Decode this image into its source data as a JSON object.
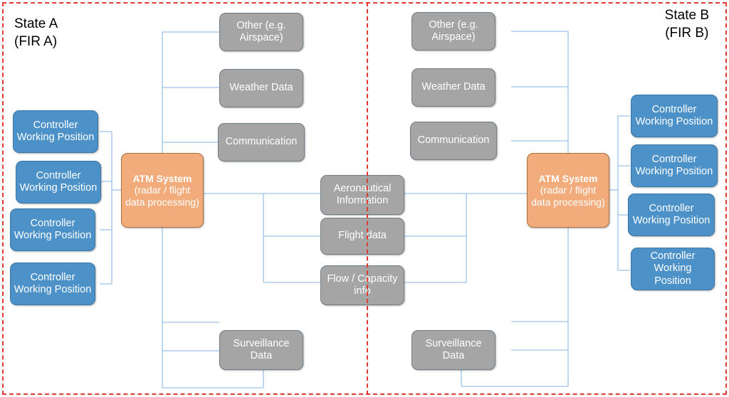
{
  "diagram": {
    "title_left": {
      "line1": "State A",
      "line2": "(FIR A)"
    },
    "title_right": {
      "line1": "State B",
      "line2": "(FIR B)"
    },
    "colors": {
      "blue": "#4C91C8",
      "gray": "#A5A5A5",
      "orange": "#F2AC7C",
      "border_red": "#E03A34",
      "connector": "#9DC3E6",
      "text": "#FFFFFF"
    },
    "state_a": {
      "controller_positions": [
        {
          "l1": "Controller",
          "l2": "Working",
          "l3": "Position"
        },
        {
          "l1": "Controller",
          "l2": "Working",
          "l3": "Position"
        },
        {
          "l1": "Controller",
          "l2": "Working",
          "l3": "Position"
        },
        {
          "l1": "Controller",
          "l2": "Working",
          "l3": "Position"
        }
      ],
      "atm": {
        "title": "ATM System",
        "l1": "(radar / flight",
        "l2": "data",
        "l3": "processing)"
      },
      "services": [
        {
          "l1": "Other",
          "l2": "(e.g. Airspace)"
        },
        {
          "l1": "Weather Data",
          "l2": ""
        },
        {
          "l1": "Communication",
          "l2": ""
        }
      ],
      "surveillance": {
        "l1": "Surveillance",
        "l2": "Data"
      }
    },
    "state_b": {
      "controller_positions": [
        {
          "l1": "Controller",
          "l2": "Working",
          "l3": "Position"
        },
        {
          "l1": "Controller",
          "l2": "Working",
          "l3": "Position"
        },
        {
          "l1": "Controller",
          "l2": "Working",
          "l3": "Position"
        },
        {
          "l1": "Controller",
          "l2": "Working",
          "l3": "Position"
        }
      ],
      "atm": {
        "title": "ATM System",
        "l1": "(radar / flight",
        "l2": "data",
        "l3": "processing)"
      },
      "services": [
        {
          "l1": "Other",
          "l2": "(e.g. Airspace)"
        },
        {
          "l1": "Weather Data",
          "l2": ""
        },
        {
          "l1": "Communication",
          "l2": ""
        }
      ],
      "surveillance": {
        "l1": "Surveillance",
        "l2": "Data"
      }
    },
    "shared": [
      {
        "l1": "Aeronautical",
        "l2": "Information"
      },
      {
        "l1": "Flight data",
        "l2": ""
      },
      {
        "l1": "Flow / Capacity",
        "l2": "info"
      }
    ]
  }
}
